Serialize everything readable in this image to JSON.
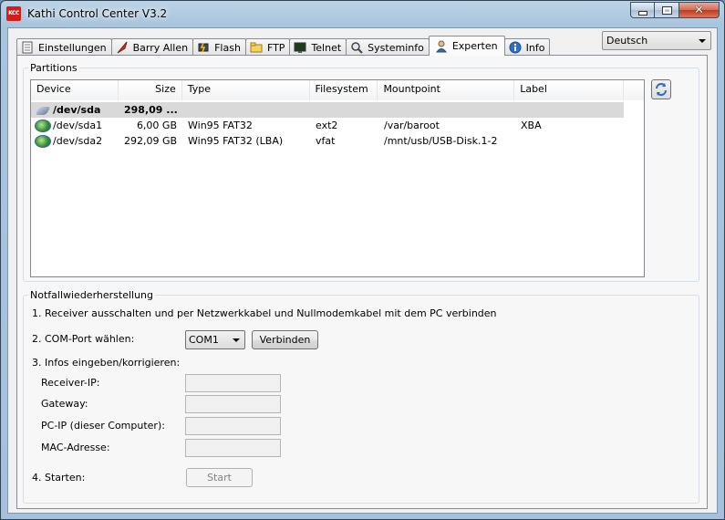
{
  "window": {
    "title": "Kathi Control Center V3.2",
    "app_icon_text": "KCC"
  },
  "language_select": {
    "value": "Deutsch"
  },
  "tabs": [
    {
      "label": "Einstellungen",
      "icon": "settings-document-icon"
    },
    {
      "label": "Barry Allen",
      "icon": "feather-icon"
    },
    {
      "label": "Flash",
      "icon": "flash-chip-icon"
    },
    {
      "label": "FTP",
      "icon": "ftp-folder-icon"
    },
    {
      "label": "Telnet",
      "icon": "terminal-icon"
    },
    {
      "label": "Systeminfo",
      "icon": "magnifier-icon"
    },
    {
      "label": "Experten",
      "icon": "user-icon",
      "active": true
    },
    {
      "label": "Info",
      "icon": "info-icon"
    }
  ],
  "partitions": {
    "group_label": "Partitions",
    "columns": [
      "Device",
      "Size",
      "Type",
      "Filesystem",
      "Mountpoint",
      "Label"
    ],
    "rows": [
      {
        "device": "/dev/sda",
        "size": "298,09 ...",
        "type": "",
        "filesystem": "",
        "mountpoint": "",
        "label": "",
        "selected": true,
        "icon": "hard-drive-icon"
      },
      {
        "device": "/dev/sda1",
        "size": "6,00 GB",
        "type": "Win95 FAT32",
        "filesystem": "ext2",
        "mountpoint": "/var/baroot",
        "label": "XBA",
        "icon": "partition-icon"
      },
      {
        "device": "/dev/sda2",
        "size": "292,09 GB",
        "type": "Win95 FAT32 (LBA)",
        "filesystem": "vfat",
        "mountpoint": "/mnt/usb/USB-Disk.1-2",
        "label": "",
        "icon": "partition-icon"
      }
    ]
  },
  "recovery": {
    "group_label": "Notfallwiederherstellung",
    "step1": "1. Receiver ausschalten und per Netzwerkkabel und Nullmodemkabel mit dem PC verbinden",
    "step2": "2. COM-Port wählen:",
    "com_port": "COM1",
    "connect_button": "Verbinden",
    "step3": "3. Infos eingeben/korrigieren:",
    "fields": {
      "receiver_ip": {
        "label": "Receiver-IP:",
        "value": ""
      },
      "gateway": {
        "label": "Gateway:",
        "value": ""
      },
      "pc_ip": {
        "label": "PC-IP (dieser Computer):",
        "value": ""
      },
      "mac": {
        "label": "MAC-Adresse:",
        "value": ""
      }
    },
    "step4": "4. Starten:",
    "start_button": "Start"
  }
}
